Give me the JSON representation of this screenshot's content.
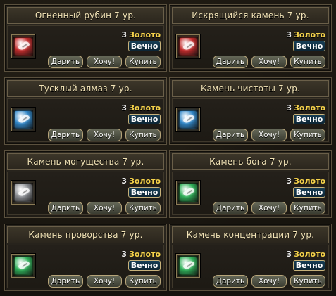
{
  "colors": {
    "red": "#c32b2b",
    "blue": "#2f86c8",
    "grey": "#8c8f94",
    "green": "#2fb159",
    "gold": "#f5d24b"
  },
  "cards": [
    {
      "title": "Огненный рубин 7 ур.",
      "price": "3",
      "currency": "Золото",
      "duration": "Вечно",
      "gem_icon": "red-gem-icon",
      "gem_color": "red",
      "buttons": {
        "gift": "Дарить",
        "want": "Хочу!",
        "buy": "Купить"
      }
    },
    {
      "title": "Искрящийся камень 7 ур.",
      "price": "3",
      "currency": "Золото",
      "duration": "Вечно",
      "gem_icon": "red-gem-icon",
      "gem_color": "red",
      "buttons": {
        "gift": "Дарить",
        "want": "Хочу!",
        "buy": "Купить"
      }
    },
    {
      "title": "Тусклый алмаз 7 ур.",
      "price": "3",
      "currency": "Золото",
      "duration": "Вечно",
      "gem_icon": "blue-gem-icon",
      "gem_color": "blue",
      "buttons": {
        "gift": "Дарить",
        "want": "Хочу!",
        "buy": "Купить"
      }
    },
    {
      "title": "Камень чистоты 7 ур.",
      "price": "3",
      "currency": "Золото",
      "duration": "Вечно",
      "gem_icon": "blue-gem-icon",
      "gem_color": "blue",
      "buttons": {
        "gift": "Дарить",
        "want": "Хочу!",
        "buy": "Купить"
      }
    },
    {
      "title": "Камень могущества 7 ур.",
      "price": "3",
      "currency": "Золото",
      "duration": "Вечно",
      "gem_icon": "grey-gem-icon",
      "gem_color": "grey",
      "buttons": {
        "gift": "Дарить",
        "want": "Хочу!",
        "buy": "Купить"
      }
    },
    {
      "title": "Камень бога 7 ур.",
      "price": "3",
      "currency": "Золото",
      "duration": "Вечно",
      "gem_icon": "green-gem-icon",
      "gem_color": "green",
      "buttons": {
        "gift": "Дарить",
        "want": "Хочу!",
        "buy": "Купить"
      }
    },
    {
      "title": "Камень проворства 7 ур.",
      "price": "3",
      "currency": "Золото",
      "duration": "Вечно",
      "gem_icon": "green-gem-icon",
      "gem_color": "green",
      "buttons": {
        "gift": "Дарить",
        "want": "Хочу!",
        "buy": "Купить"
      }
    },
    {
      "title": "Камень концентрации 7 ур.",
      "price": "3",
      "currency": "Золото",
      "duration": "Вечно",
      "gem_icon": "green-gem-icon",
      "gem_color": "green",
      "buttons": {
        "gift": "Дарить",
        "want": "Хочу!",
        "buy": "Купить"
      }
    }
  ]
}
